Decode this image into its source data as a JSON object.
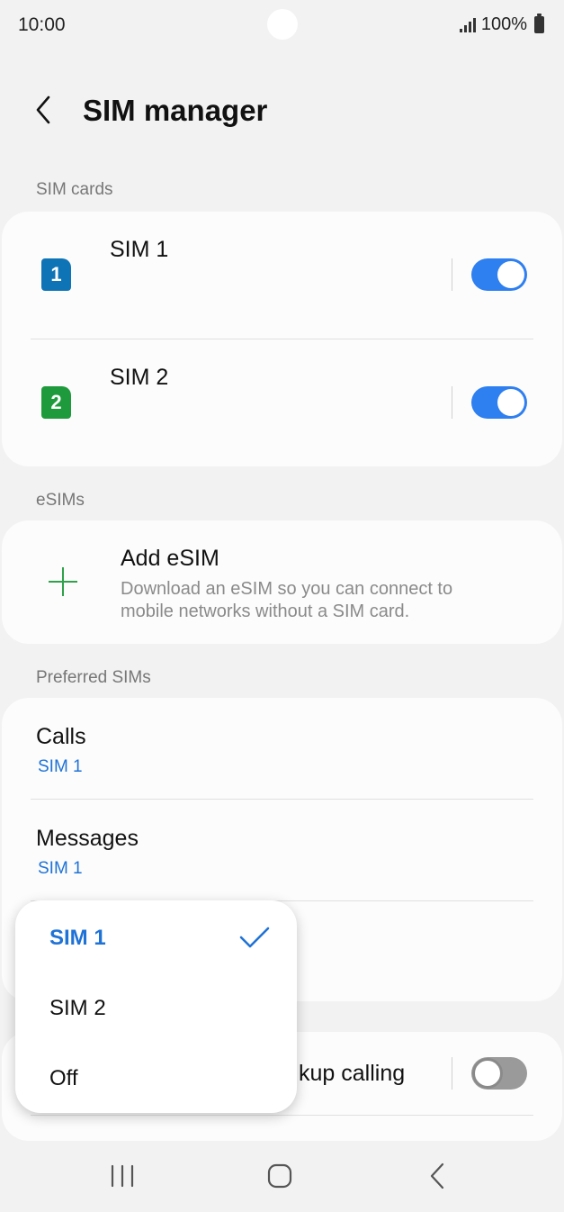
{
  "status_bar": {
    "time": "10:00",
    "battery": "100%"
  },
  "header": {
    "title": "SIM manager"
  },
  "sections": {
    "sim_cards": "SIM cards",
    "esims": "eSIMs",
    "preferred": "Preferred SIMs"
  },
  "sim_cards": [
    {
      "name": "SIM 1",
      "badge": "1",
      "color": "#0f74b6",
      "enabled": true
    },
    {
      "name": "SIM 2",
      "badge": "2",
      "color": "#1e9a3c",
      "enabled": true
    }
  ],
  "esim": {
    "title": "Add eSIM",
    "description": "Download an eSIM so you can connect to mobile networks without a SIM card."
  },
  "preferred": [
    {
      "title": "Calls",
      "value": "SIM 1"
    },
    {
      "title": "Messages",
      "value": "SIM 1"
    }
  ],
  "backup_calling": {
    "label_visible": "kup calling",
    "enabled": false
  },
  "dropdown": {
    "options": [
      "SIM 1",
      "SIM 2",
      "Off"
    ],
    "selected": "SIM 1"
  },
  "colors": {
    "accent": "#1f72d6",
    "toggle_on": "#2e7ff0",
    "plus": "#2fa14a"
  },
  "icons": {
    "back": "back-arrow-icon",
    "add": "plus-icon",
    "check": "check-icon",
    "nav_recent": "recent-apps-icon",
    "nav_home": "home-icon",
    "nav_back": "back-icon"
  }
}
